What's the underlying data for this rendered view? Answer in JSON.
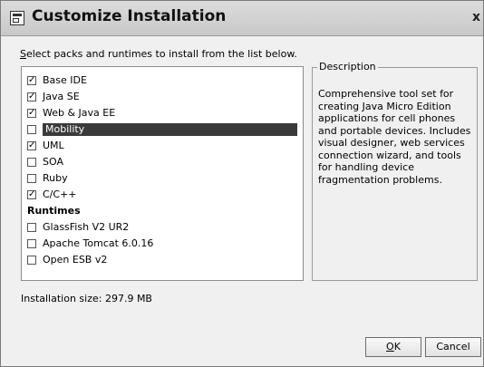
{
  "window": {
    "title": "Customize Installation",
    "close_symbol": "x"
  },
  "instruction": {
    "mnemonic": "S",
    "rest": "elect packs and runtimes to install from the list below."
  },
  "packs": [
    {
      "label": "Base IDE",
      "checked": true
    },
    {
      "label": "Java SE",
      "checked": true
    },
    {
      "label": "Web & Java EE",
      "checked": true
    },
    {
      "label": "Mobility",
      "checked": false,
      "selected": true
    },
    {
      "label": "UML",
      "checked": true
    },
    {
      "label": "SOA",
      "checked": false
    },
    {
      "label": "Ruby",
      "checked": false
    },
    {
      "label": "C/C++",
      "checked": true
    }
  ],
  "runtimes_heading": "Runtimes",
  "runtimes": [
    {
      "label": "GlassFish V2 UR2",
      "checked": false
    },
    {
      "label": "Apache Tomcat 6.0.16",
      "checked": false
    },
    {
      "label": "Open ESB v2",
      "checked": false
    }
  ],
  "description": {
    "legend": "Description",
    "text": "Comprehensive tool set for creating Java Micro Edition applications for cell phones and portable devices. Includes visual designer, web services connection wizard, and tools for handling device fragmentation problems."
  },
  "installation_size": "Installation size: 297.9 MB",
  "buttons": {
    "ok_mnemonic": "O",
    "ok_rest": "K",
    "cancel": "Cancel"
  },
  "icons": {
    "app": "installer-window-icon",
    "check": "checkmark-icon"
  }
}
